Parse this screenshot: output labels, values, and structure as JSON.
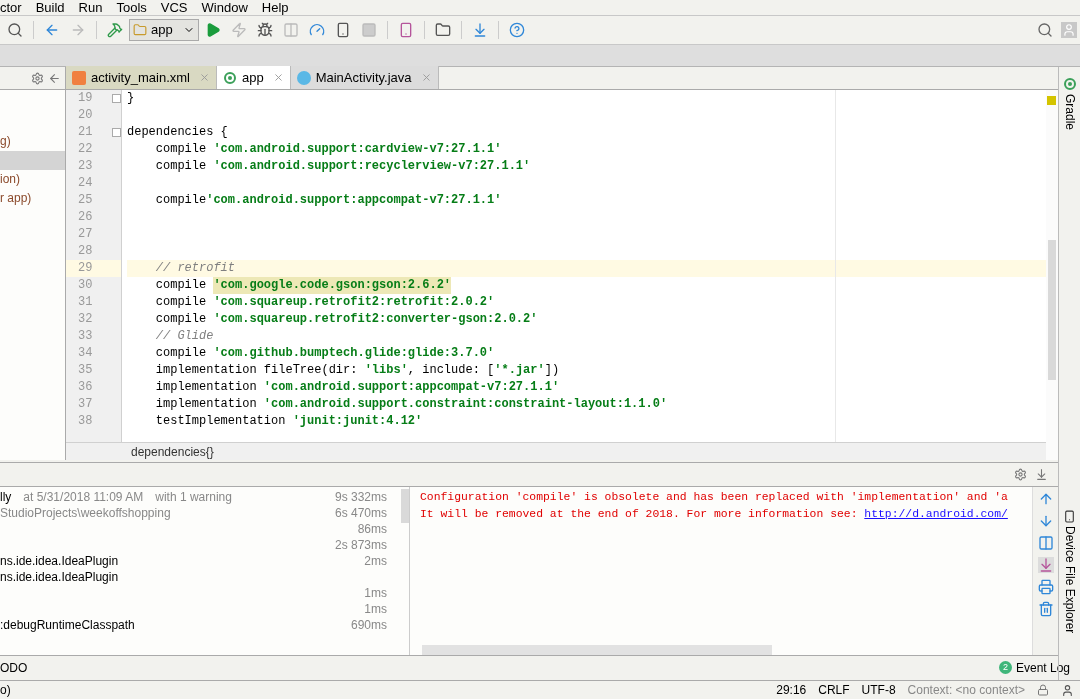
{
  "menu": [
    "ctor",
    "Build",
    "Run",
    "Tools",
    "VCS",
    "Window",
    "Help"
  ],
  "toolbar": {
    "run_config": "app"
  },
  "project_panel": {
    "items": [
      {
        "text": "g)",
        "selected": false
      },
      {
        "selected": true
      },
      {
        "text": "ion)",
        "selected": false
      },
      {
        "text": "r app)",
        "selected": false
      }
    ]
  },
  "tabs": [
    {
      "label": "activity_main.xml",
      "kind": "xml",
      "selected": false
    },
    {
      "label": "app",
      "kind": "gradle",
      "selected": true
    },
    {
      "label": "MainActivity.java",
      "kind": "java",
      "selected": false
    }
  ],
  "editor": {
    "lines": [
      {
        "number": "19",
        "fold": true,
        "segments": [
          {
            "text": "}",
            "kind": "plain"
          }
        ]
      },
      {
        "number": "20"
      },
      {
        "number": "21",
        "fold": true,
        "segments": [
          {
            "text": "dependencies {",
            "kind": "plain"
          }
        ]
      },
      {
        "number": "22",
        "segments": [
          {
            "text": "    compile ",
            "kind": "plain"
          },
          {
            "text": "'com.android.support:cardview-v7:27.1.1'",
            "kind": "string"
          }
        ]
      },
      {
        "number": "23",
        "segments": [
          {
            "text": "    compile ",
            "kind": "plain"
          },
          {
            "text": "'com.android.support:recyclerview-v7:27.1.1'",
            "kind": "string"
          }
        ]
      },
      {
        "number": "24"
      },
      {
        "number": "25",
        "segments": [
          {
            "text": "    compile",
            "kind": "plain"
          },
          {
            "text": "'com.android.support:appcompat-v7:27.1.1'",
            "kind": "string"
          }
        ]
      },
      {
        "number": "26"
      },
      {
        "number": "27"
      },
      {
        "number": "28"
      },
      {
        "number": "29",
        "current": true,
        "segments": [
          {
            "text": "    // retrofit",
            "kind": "comment"
          }
        ]
      },
      {
        "number": "30",
        "segments": [
          {
            "text": "    compile ",
            "kind": "plain"
          },
          {
            "text": "'com.google.code.gson:gson:2.6.2'",
            "kind": "match"
          }
        ]
      },
      {
        "number": "31",
        "segments": [
          {
            "text": "    compile ",
            "kind": "plain"
          },
          {
            "text": "'com.squareup.retrofit2:retrofit:2.0.2'",
            "kind": "string"
          }
        ]
      },
      {
        "number": "32",
        "segments": [
          {
            "text": "    compile ",
            "kind": "plain"
          },
          {
            "text": "'com.squareup.retrofit2:converter-gson:2.0.2'",
            "kind": "string"
          }
        ]
      },
      {
        "number": "33",
        "segments": [
          {
            "text": "    // Glide",
            "kind": "comment"
          }
        ]
      },
      {
        "number": "34",
        "segments": [
          {
            "text": "    compile ",
            "kind": "plain"
          },
          {
            "text": "'com.github.bumptech.glide:glide:3.7.0'",
            "kind": "string"
          }
        ]
      },
      {
        "number": "35",
        "segments": [
          {
            "text": "    implementation fileTree(dir: ",
            "kind": "plain"
          },
          {
            "text": "'libs'",
            "kind": "string"
          },
          {
            "text": ", include: [",
            "kind": "plain"
          },
          {
            "text": "'*.jar'",
            "kind": "string"
          },
          {
            "text": "])",
            "kind": "plain"
          }
        ]
      },
      {
        "number": "36",
        "segments": [
          {
            "text": "    implementation ",
            "kind": "plain"
          },
          {
            "text": "'com.android.support:appcompat-v7:27.1.1'",
            "kind": "string"
          }
        ]
      },
      {
        "number": "37",
        "segments": [
          {
            "text": "    implementation ",
            "kind": "plain"
          },
          {
            "text": "'com.android.support.constraint:constraint-layout:1.1.0'",
            "kind": "string"
          }
        ]
      },
      {
        "number": "38",
        "segments": [
          {
            "text": "    testImplementation ",
            "kind": "plain"
          },
          {
            "text": "'junit:junit:4.12'",
            "kind": "string"
          }
        ]
      }
    ],
    "breadcrumb": "dependencies{}"
  },
  "build_tree": [
    {
      "title": "lly",
      "details": [
        "at 5/31/2018 11:09 AM",
        "with 1 warning"
      ],
      "time": "9s 332ms"
    },
    {
      "path": "StudioProjects\\weekoffshopping",
      "time": "6s 470ms"
    },
    {
      "time": "86ms"
    },
    {
      "time": "2s 873ms"
    },
    {
      "title": "ns.ide.idea.IdeaPlugin",
      "time": "2ms"
    },
    {
      "title": "ns.ide.idea.IdeaPlugin"
    },
    {
      "time": "1ms"
    },
    {
      "time": "1ms"
    },
    {
      "title": ":debugRuntimeClasspath",
      "time": "690ms"
    }
  ],
  "console": [
    {
      "segments": [
        {
          "text": "Configuration 'compile' is obsolete and has been replaced with 'implementation' and 'a",
          "kind": "error"
        }
      ]
    },
    {
      "segments": [
        {
          "text": "It will be removed at the end of 2018. For more information see: ",
          "kind": "error"
        },
        {
          "text": "http://d.android.com/",
          "kind": "link"
        }
      ]
    }
  ],
  "side_tools": {
    "right_top": "Gradle",
    "right_bottom": "Device File Explorer"
  },
  "tool_bar": {
    "left": "ODO",
    "event_log": {
      "label": "Event Log",
      "badge": "2"
    }
  },
  "status_bar": {
    "left": "o)",
    "position": "29:16",
    "line_separator": "CRLF",
    "encoding": "UTF-8",
    "context": "Context: <no context>"
  }
}
